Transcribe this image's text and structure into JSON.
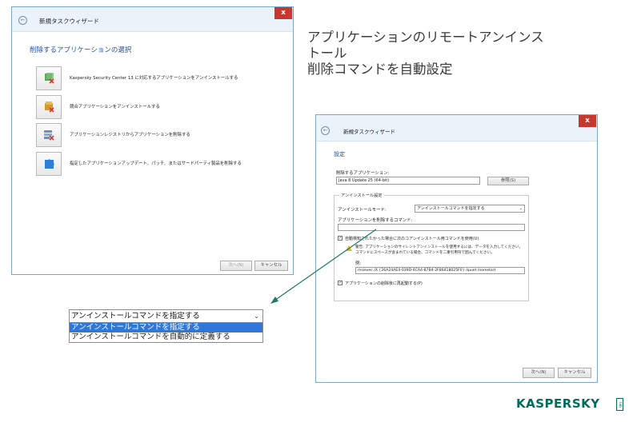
{
  "window1": {
    "title": "新規タスクウィザード",
    "close": "x",
    "back": "←",
    "section_title": "削除するアプリケーションの選択",
    "options": [
      {
        "label": "Kaspersky Security Center 13 に対応するアプリケーションをアンインストールする",
        "icon": "package-remove-icon"
      },
      {
        "label": "競合アプリケーションをアンインストールする",
        "icon": "box-conflict-icon"
      },
      {
        "label": "アプリケーションレジストリからアプリケーションを削除する",
        "icon": "registry-remove-icon"
      },
      {
        "label": "指定したアプリケーションアップデート、パッチ、またはサードパーティ製品を削除する",
        "icon": "puzzle-update-icon"
      }
    ],
    "next_button": "次へ(N)",
    "cancel_button": "キャンセル"
  },
  "headline": {
    "line1": "アプリケーションのリモートアンインス",
    "line2": "トール",
    "line3": "削除コマンドを自動設定"
  },
  "window2": {
    "title": "新規タスクウィザード",
    "close": "x",
    "back": "←",
    "section_title": "設定",
    "app_label": "削除するアプリケーション:",
    "app_value": "Java 8 Update 25 (64-bit)",
    "browse_button": "参照(S)",
    "group_title": "アンインストール設定",
    "mode_label": "アンインストールモード:",
    "mode_value": "アンインストールコマンドを指定する",
    "command_label": "アプリケーションを削除するコマンド:",
    "command_value": "",
    "auto_detect_label": "自動検知されたかった場合に次のコアンインストール用コマンドを使用(U)",
    "auto_detect_checked": "✓",
    "warning_text_1": "警告: アプリケーションのサイレントアンインストールを使用するには、データを入力してください。",
    "warning_text_2": "コマンドにスペースが含まれている場合、コマンドを二重引用符で囲んでください。",
    "example_label": "例:",
    "example_value": "msiexec /X {26A24AE4-039D-4CA4-87B4-2F86418025F0} /quiet /norestart",
    "restart_label": "アプリケーションの削除後に再起動する(P)",
    "restart_checked": "✓",
    "next_button": "次へ(N)",
    "cancel_button": "キャンセル"
  },
  "dropdown_zoom": {
    "selected_value": "アンインストールコマンドを指定する",
    "options": [
      "アンインストールコマンドを指定する",
      "アンインストールコマンドを自動的に定義する"
    ],
    "arrow": "⌄"
  },
  "logo": {
    "text": "KASPERSKY",
    "lab": "lab"
  },
  "colors": {
    "accent_blue": "#1e4f9e",
    "selection_blue": "#2f78d8",
    "close_red": "#c8372d",
    "arrow_green": "#1f7a64",
    "logo_green": "#006d5b"
  }
}
